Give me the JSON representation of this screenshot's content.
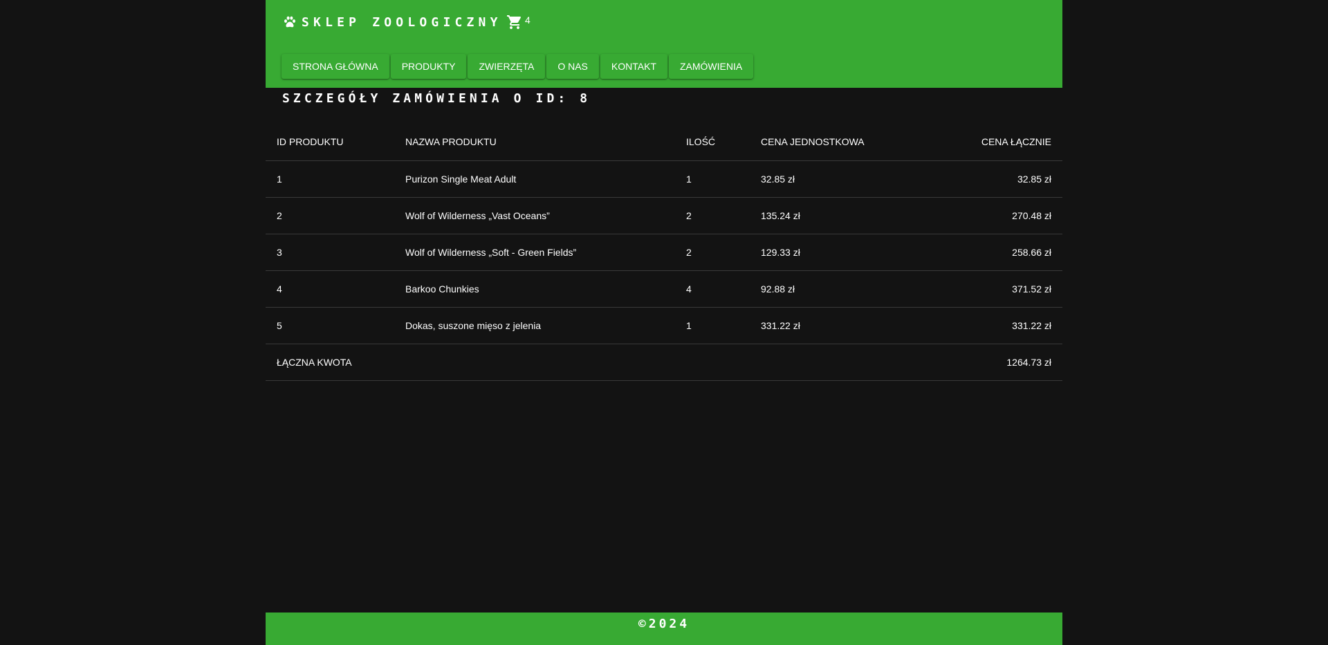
{
  "header": {
    "title": "SKLEP ZOOLOGICZNY",
    "cart_count": "4",
    "nav": [
      {
        "label": "STRONA GŁÓWNA"
      },
      {
        "label": "PRODUKTY"
      },
      {
        "label": "ZWIERZĘTA"
      },
      {
        "label": "O NAS"
      },
      {
        "label": "KONTAKT"
      },
      {
        "label": "ZAMÓWIENIA"
      }
    ]
  },
  "order": {
    "title": "SZCZEGÓŁY ZAMÓWIENIA O ID: 8",
    "columns": [
      "ID PRODUKTU",
      "NAZWA PRODUKTU",
      "ILOŚĆ",
      "CENA JEDNOSTKOWA",
      "CENA ŁĄCZNIE"
    ],
    "rows": [
      {
        "id": "1",
        "name": "Purizon Single Meat Adult",
        "qty": "1",
        "unit_price": "32.85 zł",
        "total": "32.85 zł"
      },
      {
        "id": "2",
        "name": "Wolf of Wilderness „Vast Oceans”",
        "qty": "2",
        "unit_price": "135.24 zł",
        "total": "270.48 zł"
      },
      {
        "id": "3",
        "name": "Wolf of Wilderness „Soft - Green Fields”",
        "qty": "2",
        "unit_price": "129.33 zł",
        "total": "258.66 zł"
      },
      {
        "id": "4",
        "name": "Barkoo Chunkies",
        "qty": "4",
        "unit_price": "92.88 zł",
        "total": "371.52 zł"
      },
      {
        "id": "5",
        "name": "Dokas, suszone mięso z jelenia",
        "qty": "1",
        "unit_price": "331.22 zł",
        "total": "331.22 zł"
      }
    ],
    "summary_label": "ŁĄCZNA KWOTA",
    "summary_total": "1264.73 zł"
  },
  "footer": {
    "text": "©2024"
  },
  "colors": {
    "brand_green": "#38aa33",
    "background": "#131313",
    "text": "#ffffff",
    "row_divider": "#3a3a3a"
  },
  "icons": {
    "brand": "paw-icon",
    "cart": "cart-icon"
  }
}
